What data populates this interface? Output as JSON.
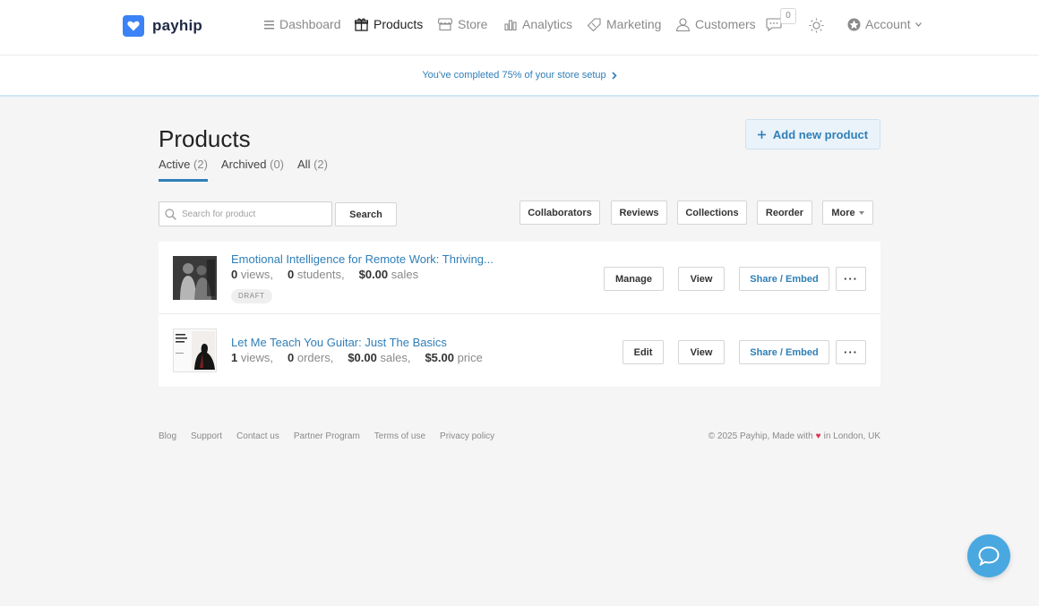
{
  "brand": {
    "name": "payhip",
    "accent": "#2f7fb8"
  },
  "nav": {
    "items": [
      {
        "label": "Dashboard",
        "icon": "menu-lines-icon",
        "active": false
      },
      {
        "label": "Products",
        "icon": "gift-box-icon",
        "active": true
      },
      {
        "label": "Store",
        "icon": "storefront-icon",
        "active": false
      },
      {
        "label": "Analytics",
        "icon": "bar-chart-icon",
        "active": false
      },
      {
        "label": "Marketing",
        "icon": "tag-icon",
        "active": false
      },
      {
        "label": "Customers",
        "icon": "user-icon",
        "active": false
      }
    ],
    "notification_count": "0",
    "account_label": "Account"
  },
  "setup": {
    "text": "You've completed 75% of your store setup",
    "progress_percent": 75
  },
  "page": {
    "title": "Products",
    "tabs": [
      {
        "label": "Active",
        "count": "(2)",
        "active": true
      },
      {
        "label": "Archived",
        "count": "(0)",
        "active": false
      },
      {
        "label": "All",
        "count": "(2)",
        "active": false
      }
    ],
    "add_button": "Add new product"
  },
  "toolbar": {
    "search_placeholder": "Search for product",
    "search_button": "Search",
    "buttons": [
      "Collaborators",
      "Reviews",
      "Collections",
      "Reorder",
      "More"
    ]
  },
  "products": [
    {
      "title": "Emotional Intelligence for Remote Work: Thriving...",
      "stats": [
        {
          "value": "0",
          "label": "views,"
        },
        {
          "value": "0",
          "label": "students,"
        },
        {
          "value": "$0.00",
          "label": "sales"
        }
      ],
      "badge": "DRAFT",
      "primary_action": "Manage",
      "view_label": "View",
      "share_label": "Share / Embed",
      "more_label": "···"
    },
    {
      "title": "Let Me Teach You Guitar: Just The Basics",
      "stats": [
        {
          "value": "1",
          "label": "views,"
        },
        {
          "value": "0",
          "label": "orders,"
        },
        {
          "value": "$0.00",
          "label": "sales,"
        },
        {
          "value": "$5.00",
          "label": "price"
        }
      ],
      "badge": "",
      "primary_action": "Edit",
      "view_label": "View",
      "share_label": "Share / Embed",
      "more_label": "···"
    }
  ],
  "footer": {
    "links": [
      "Blog",
      "Support",
      "Contact us",
      "Partner Program",
      "Terms of use",
      "Privacy policy"
    ],
    "copyright_left": "© 2025 Payhip, Made with",
    "heart": "♥",
    "copyright_right": "in London, UK"
  }
}
